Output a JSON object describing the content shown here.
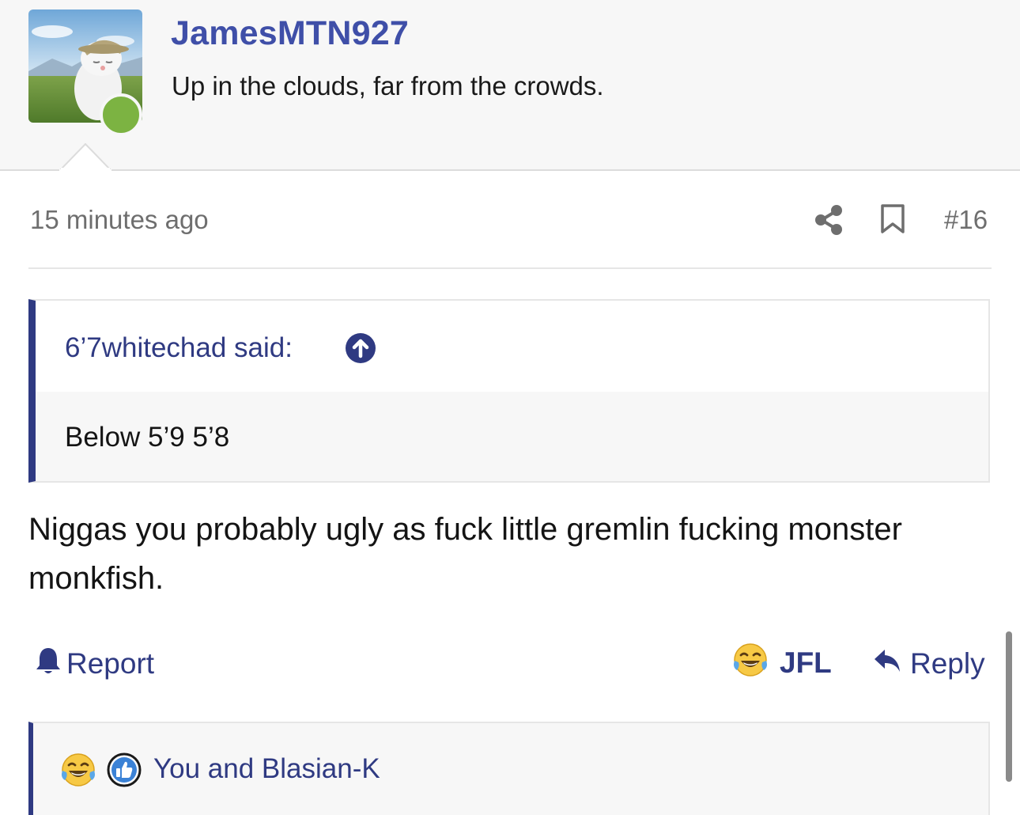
{
  "author": {
    "username": "JamesMTN927",
    "user_title": "Up in the clouds, far from the crowds.",
    "online_status_color": "#7cb342",
    "avatar_icon": "cat-avatar-image"
  },
  "post_meta": {
    "timestamp": "15 minutes ago",
    "share_icon": "share-icon",
    "bookmark_icon": "bookmark-icon",
    "post_number": "#16"
  },
  "quote": {
    "attribution": "6’7whitechad said:",
    "jump_icon": "arrow-up-circle-icon",
    "text": "Below 5’9 5’8"
  },
  "message": {
    "text": "Niggas you probably ugly as fuck little gremlin fucking monster monkfish."
  },
  "actions": {
    "report_label": "Report",
    "report_icon": "bell-icon",
    "reaction_label": "JFL",
    "reaction_icon": "laughing-crying-emoji-icon",
    "reply_label": "Reply",
    "reply_icon": "reply-arrow-icon"
  },
  "reactions": {
    "icons": [
      "laughing-crying-emoji-icon",
      "thumbs-up-icon"
    ],
    "summary": "You and Blasian-K"
  },
  "colors": {
    "accent": "#2f3a82",
    "username": "#3f4fa8",
    "muted_text": "#6e6e6e"
  }
}
